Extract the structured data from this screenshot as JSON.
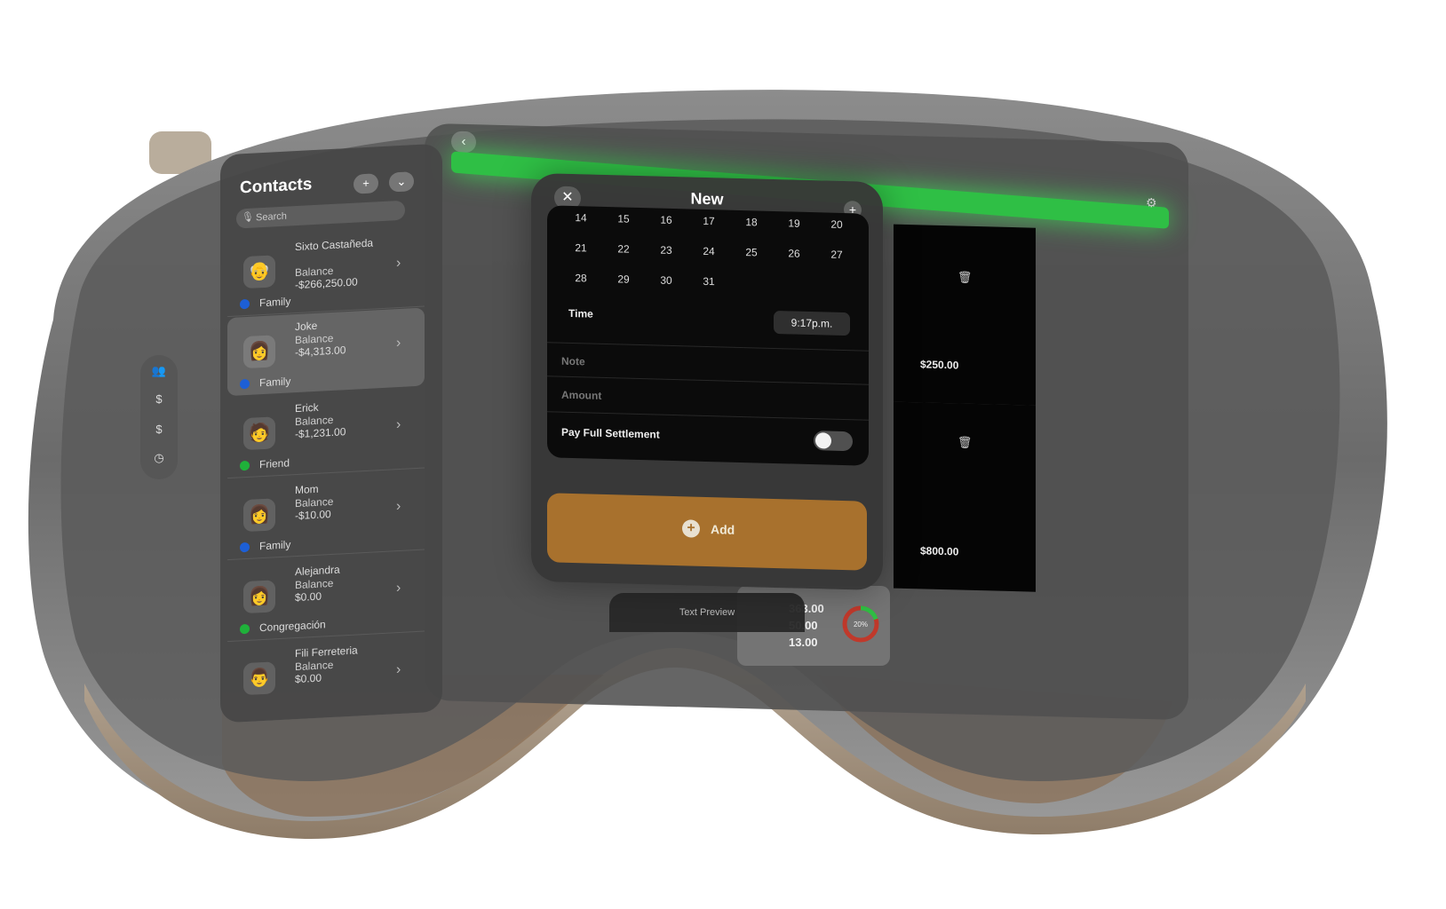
{
  "contacts": {
    "title": "Contacts",
    "add_icon": "plus-icon",
    "filter_icon": "filter-icon",
    "search_placeholder": "Search",
    "items": [
      {
        "name": "Sixto Castañeda",
        "balance_label": "Balance",
        "balance": "-$266,250.00",
        "tag": "Family",
        "tag_color": "#1d5fd6",
        "avatar": "👴"
      },
      {
        "name": "Joke",
        "balance_label": "Balance",
        "balance": "-$4,313.00",
        "tag": "Family",
        "tag_color": "#1d5fd6",
        "avatar": "👩"
      },
      {
        "name": "Erick",
        "balance_label": "Balance",
        "balance": "-$1,231.00",
        "tag": "Friend",
        "tag_color": "#1fb13a",
        "avatar": "🧑"
      },
      {
        "name": "Mom",
        "balance_label": "Balance",
        "balance": "-$10.00",
        "tag": "Family",
        "tag_color": "#1d5fd6",
        "avatar": "👩"
      },
      {
        "name": "Alejandra",
        "balance_label": "Balance",
        "balance": "$0.00",
        "tag": "Congregación",
        "tag_color": "#1fb13a",
        "avatar": "👩"
      },
      {
        "name": "Fili Ferreteria",
        "balance_label": "Balance",
        "balance": "$0.00",
        "tag": "",
        "tag_color": "",
        "avatar": "👨"
      }
    ]
  },
  "tabbar": [
    "people-icon",
    "dollar-icon",
    "dollar-icon",
    "clock-icon"
  ],
  "new_sheet": {
    "title": "New",
    "calendar_rows": [
      [
        "14",
        "15",
        "16",
        "17",
        "18",
        "19",
        "20"
      ],
      [
        "21",
        "22",
        "23",
        "24",
        "25",
        "26",
        "27"
      ],
      [
        "28",
        "29",
        "30",
        "31"
      ]
    ],
    "time_label": "Time",
    "time_value": "9:17p.m.",
    "note_placeholder": "Note",
    "amount_placeholder": "Amount",
    "pay_full_label": "Pay Full Settlement",
    "add_label": "Add"
  },
  "receipts": [
    {
      "amount": "$250.00"
    },
    {
      "amount": "$800.00"
    }
  ],
  "summary": {
    "lines": [
      "363.00",
      "50.00",
      "13.00"
    ],
    "percent_label": "20%",
    "percent": 20
  },
  "text_preview": "Text Preview",
  "colors": {
    "accent_green": "#2fbf45",
    "add_button": "#a8712d"
  }
}
